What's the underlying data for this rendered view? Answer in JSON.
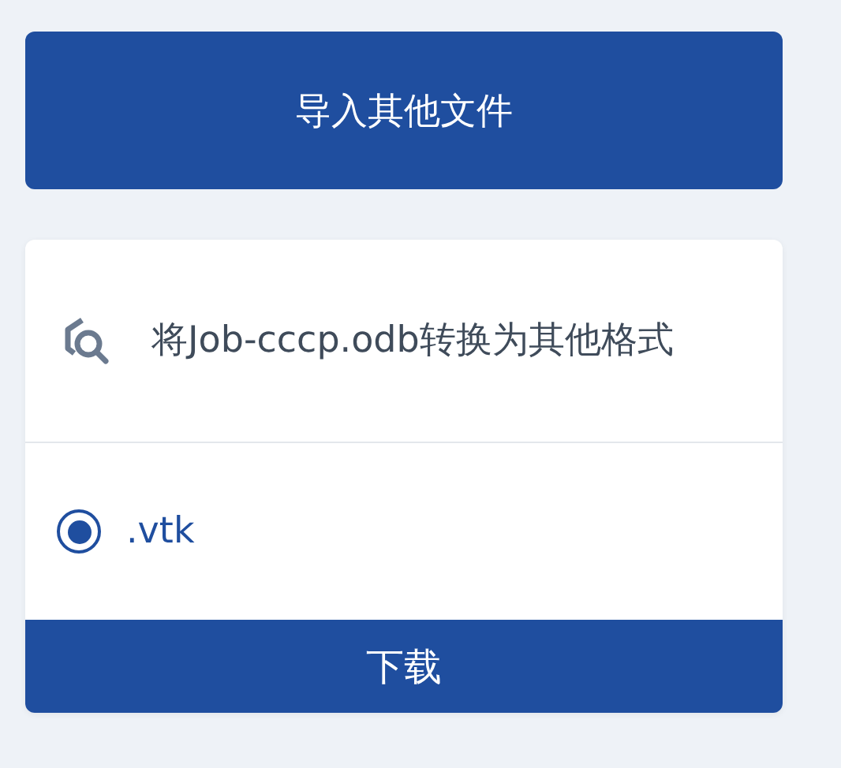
{
  "import_button": {
    "label": "导入其他文件"
  },
  "convert_panel": {
    "title": "将Job-cccp.odb转换为其他格式",
    "formats": [
      {
        "label": ".vtk",
        "selected": true
      }
    ],
    "download_button": {
      "label": "下载"
    }
  }
}
